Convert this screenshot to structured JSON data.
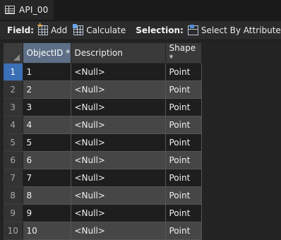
{
  "window": {
    "title": "API_00",
    "icon": "table-icon"
  },
  "toolbar": {
    "field_label": "Field:",
    "add_label": "Add",
    "calculate_label": "Calculate",
    "selection_label": "Selection:",
    "select_by_attributes_label": "Select By Attributes"
  },
  "table": {
    "columns": [
      "ObjectID *",
      "Description",
      "Shape *"
    ],
    "rows": [
      {
        "index": "1",
        "objectid": "1",
        "description": "<Null>",
        "shape": "Point"
      },
      {
        "index": "2",
        "objectid": "2",
        "description": "<Null>",
        "shape": "Point"
      },
      {
        "index": "3",
        "objectid": "3",
        "description": "<Null>",
        "shape": "Point"
      },
      {
        "index": "4",
        "objectid": "4",
        "description": "<Null>",
        "shape": "Point"
      },
      {
        "index": "5",
        "objectid": "5",
        "description": "<Null>",
        "shape": "Point"
      },
      {
        "index": "6",
        "objectid": "6",
        "description": "<Null>",
        "shape": "Point"
      },
      {
        "index": "7",
        "objectid": "7",
        "description": "<Null>",
        "shape": "Point"
      },
      {
        "index": "8",
        "objectid": "8",
        "description": "<Null>",
        "shape": "Point"
      },
      {
        "index": "9",
        "objectid": "9",
        "description": "<Null>",
        "shape": "Point"
      },
      {
        "index": "10",
        "objectid": "10",
        "description": "<Null>",
        "shape": "Point"
      }
    ]
  },
  "colors": {
    "selected_row": "#3b6fb6",
    "selected_header": "#5d6f86",
    "background": "#232323"
  }
}
